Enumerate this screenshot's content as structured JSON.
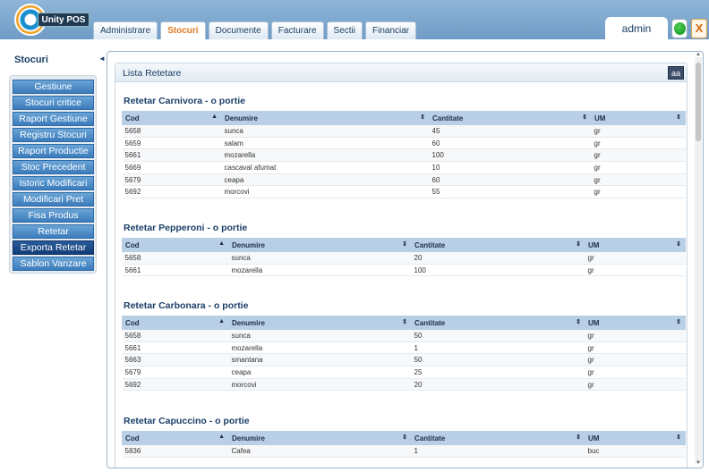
{
  "logo": {
    "text": "Unity POS"
  },
  "tabs": [
    "Administrare",
    "Stocuri",
    "Documente",
    "Facturare",
    "Sectii",
    "Financiar"
  ],
  "active_tab": 1,
  "header": {
    "user": "admin",
    "close_label": "X"
  },
  "sidebar": {
    "title": "Stocuri",
    "collapse_arrow": "◄",
    "items": [
      "Gestiune",
      "Stocuri critice",
      "Raport Gestiune",
      "Registru Stocuri",
      "Raport Productie",
      "Stoc Precedent",
      "Istoric Modificari",
      "Modificari Pret",
      "Fisa Produs",
      "Retetar",
      "Exporta Retetar",
      "Sablon Vanzare"
    ],
    "active_item": 10
  },
  "panel": {
    "title": "Lista Retetare",
    "font_button": "aa"
  },
  "columns": [
    "Cod",
    "Denumire",
    "Cantitate",
    "UM"
  ],
  "recipes": [
    {
      "title": "Retetar Carnivora - o portie",
      "rows": [
        [
          "5658",
          "sunca",
          "45",
          "gr"
        ],
        [
          "5659",
          "salam",
          "60",
          "gr"
        ],
        [
          "5661",
          "mozarella",
          "100",
          "gr"
        ],
        [
          "5669",
          "cascaval afumat",
          "10",
          "gr"
        ],
        [
          "5679",
          "ceapa",
          "60",
          "gr"
        ],
        [
          "5692",
          "morcovi",
          "55",
          "gr"
        ]
      ]
    },
    {
      "title": "Retetar Pepperoni - o portie",
      "rows": [
        [
          "5658",
          "sunca",
          "20",
          "gr"
        ],
        [
          "5661",
          "mozarella",
          "100",
          "gr"
        ]
      ]
    },
    {
      "title": "Retetar Carbonara - o portie",
      "rows": [
        [
          "5658",
          "sunca",
          "50",
          "gr"
        ],
        [
          "5661",
          "mozarella",
          "1",
          "gr"
        ],
        [
          "5663",
          "smantana",
          "50",
          "gr"
        ],
        [
          "5679",
          "ceapa",
          "25",
          "gr"
        ],
        [
          "5692",
          "morcovi",
          "20",
          "gr"
        ]
      ]
    },
    {
      "title": "Retetar Capuccino - o portie",
      "rows": [
        [
          "5836",
          "Cafea",
          "1",
          "buc"
        ]
      ]
    }
  ]
}
